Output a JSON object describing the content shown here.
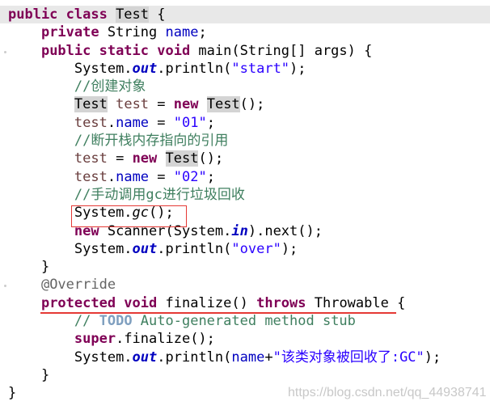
{
  "editor": {
    "lines": [
      {
        "indent": 0,
        "current": true,
        "tokens": [
          {
            "t": "public class ",
            "c": "kw"
          },
          {
            "t": "Test",
            "c": "hl"
          },
          {
            "t": " {",
            "c": ""
          }
        ]
      },
      {
        "indent": 1,
        "tokens": [
          {
            "t": "private ",
            "c": "kw"
          },
          {
            "t": "String ",
            "c": ""
          },
          {
            "t": "name",
            "c": "fld"
          },
          {
            "t": ";",
            "c": ""
          }
        ]
      },
      {
        "indent": 1,
        "tokens": [
          {
            "t": "public static void ",
            "c": "kw"
          },
          {
            "t": "main(String[] args) {",
            "c": ""
          }
        ]
      },
      {
        "indent": 2,
        "tokens": [
          {
            "t": "System.",
            "c": ""
          },
          {
            "t": "out",
            "c": "stat"
          },
          {
            "t": ".println(",
            "c": ""
          },
          {
            "t": "\"start\"",
            "c": "st"
          },
          {
            "t": ");",
            "c": ""
          }
        ]
      },
      {
        "indent": 2,
        "tokens": [
          {
            "t": "//创建对象",
            "c": "cm"
          }
        ]
      },
      {
        "indent": 2,
        "tokens": [
          {
            "t": "Test",
            "c": "hl"
          },
          {
            "t": " ",
            "c": ""
          },
          {
            "t": "test",
            "c": "var"
          },
          {
            "t": " = ",
            "c": ""
          },
          {
            "t": "new ",
            "c": "kw"
          },
          {
            "t": "Test",
            "c": "hl"
          },
          {
            "t": "();",
            "c": ""
          }
        ]
      },
      {
        "indent": 2,
        "tokens": [
          {
            "t": "test",
            "c": "var"
          },
          {
            "t": ".",
            "c": ""
          },
          {
            "t": "name",
            "c": "fld"
          },
          {
            "t": " = ",
            "c": ""
          },
          {
            "t": "\"01\"",
            "c": "st"
          },
          {
            "t": ";",
            "c": ""
          }
        ]
      },
      {
        "indent": 2,
        "tokens": [
          {
            "t": "//断开栈内存指向的引用",
            "c": "cm"
          }
        ]
      },
      {
        "indent": 2,
        "tokens": [
          {
            "t": "test",
            "c": "var"
          },
          {
            "t": " = ",
            "c": ""
          },
          {
            "t": "new ",
            "c": "kw"
          },
          {
            "t": "Test",
            "c": "hl"
          },
          {
            "t": "();",
            "c": ""
          }
        ]
      },
      {
        "indent": 2,
        "tokens": [
          {
            "t": "test",
            "c": "var"
          },
          {
            "t": ".",
            "c": ""
          },
          {
            "t": "name",
            "c": "fld"
          },
          {
            "t": " = ",
            "c": ""
          },
          {
            "t": "\"02\"",
            "c": "st"
          },
          {
            "t": ";",
            "c": ""
          }
        ]
      },
      {
        "indent": 2,
        "tokens": [
          {
            "t": "//手动调用gc进行垃圾回收",
            "c": "cm"
          }
        ]
      },
      {
        "indent": 2,
        "tokens": [
          {
            "t": "System.",
            "c": ""
          },
          {
            "t": "gc",
            "c": "it"
          },
          {
            "t": "();",
            "c": ""
          }
        ]
      },
      {
        "indent": 2,
        "tokens": [
          {
            "t": "new ",
            "c": "kw"
          },
          {
            "t": "Scanner(System.",
            "c": ""
          },
          {
            "t": "in",
            "c": "stat"
          },
          {
            "t": ").next();",
            "c": ""
          }
        ]
      },
      {
        "indent": 2,
        "tokens": [
          {
            "t": "System.",
            "c": ""
          },
          {
            "t": "out",
            "c": "stat"
          },
          {
            "t": ".println(",
            "c": ""
          },
          {
            "t": "\"over\"",
            "c": "st"
          },
          {
            "t": ");",
            "c": ""
          }
        ]
      },
      {
        "indent": 1,
        "tokens": [
          {
            "t": "}",
            "c": ""
          }
        ]
      },
      {
        "indent": 1,
        "tokens": [
          {
            "t": "@Override",
            "c": "ann"
          }
        ]
      },
      {
        "indent": 1,
        "tokens": [
          {
            "t": "protected void ",
            "c": "kw"
          },
          {
            "t": "finalize() ",
            "c": ""
          },
          {
            "t": "throws ",
            "c": "kw"
          },
          {
            "t": "Throwable {",
            "c": ""
          }
        ]
      },
      {
        "indent": 2,
        "tokens": [
          {
            "t": "// ",
            "c": "cm"
          },
          {
            "t": "TODO",
            "c": "todo"
          },
          {
            "t": " Auto-generated method stub",
            "c": "cm"
          }
        ]
      },
      {
        "indent": 2,
        "tokens": [
          {
            "t": "super",
            "c": "kw"
          },
          {
            "t": ".finalize();",
            "c": ""
          }
        ]
      },
      {
        "indent": 2,
        "tokens": [
          {
            "t": "System.",
            "c": ""
          },
          {
            "t": "out",
            "c": "stat"
          },
          {
            "t": ".println(",
            "c": ""
          },
          {
            "t": "name",
            "c": "fld"
          },
          {
            "t": "+",
            "c": ""
          },
          {
            "t": "\"该类对象被回收了:GC\"",
            "c": "st"
          },
          {
            "t": ");",
            "c": ""
          }
        ]
      },
      {
        "indent": 1,
        "tokens": [
          {
            "t": "}",
            "c": ""
          }
        ]
      },
      {
        "indent": 0,
        "tokens": [
          {
            "t": "}",
            "c": ""
          }
        ]
      }
    ]
  },
  "watermark": "https://blog.csdn.net/qq_44938741",
  "colors": {
    "keyword": "#7f0055",
    "field": "#0000c0",
    "string": "#2a00ff",
    "comment": "#3f7f5f",
    "annotation_box": "#e53935"
  }
}
